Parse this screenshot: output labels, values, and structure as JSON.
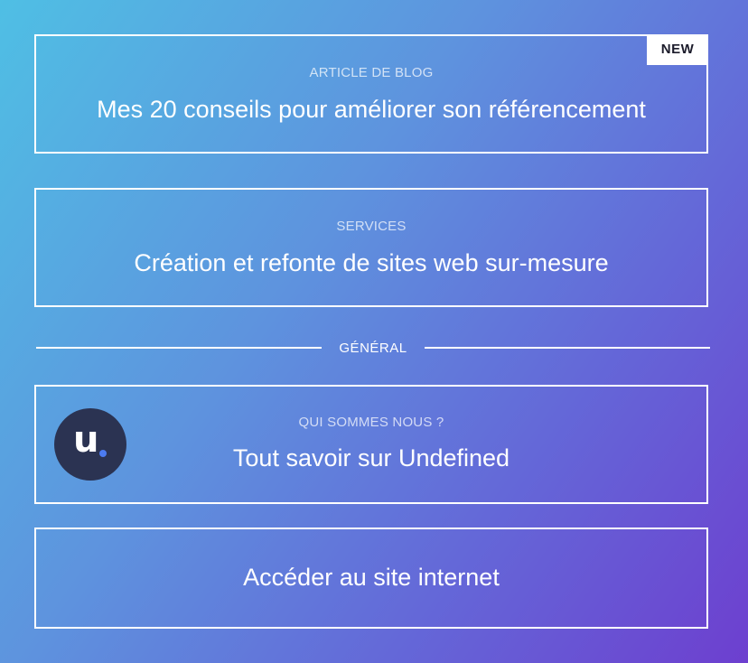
{
  "cards": {
    "blog": {
      "badge": "NEW",
      "eyebrow": "ARTICLE DE BLOG",
      "title": "Mes 20 conseils pour améliorer son référencement"
    },
    "services": {
      "eyebrow": "SERVICES",
      "title": "Création et refonte de sites web sur-mesure"
    },
    "about": {
      "logo_letter": "u",
      "eyebrow": "QUI SOMMES NOUS ?",
      "title": "Tout savoir sur Undefined"
    },
    "website": {
      "title": "Accéder au site internet"
    }
  },
  "divider": {
    "label": "GÉNÉRAL"
  },
  "colors": {
    "gradient_start": "#4fbfe4",
    "gradient_end": "#6d3fcf",
    "logo_bg": "#2b3352",
    "logo_dot": "#4c7bf0",
    "badge_bg": "#ffffff"
  }
}
